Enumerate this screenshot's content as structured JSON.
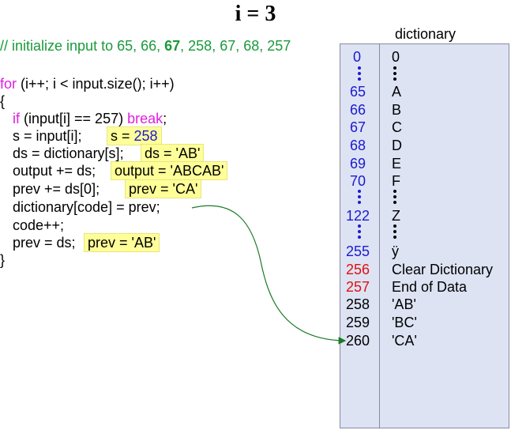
{
  "title": "i = 3",
  "code": {
    "comment_prefix": "// initialize input to 65, 66, ",
    "comment_bold": "67",
    "comment_suffix": ", 258, 67, 68, 257",
    "for_kw": "for",
    "for_rest": " (i++; i < input.size(); i++)",
    "open_brace": "{",
    "if_kw": "if",
    "if_mid": " (input[i] == 257) ",
    "break_kw": "break",
    "if_end": ";",
    "line_s": "s = input[i];",
    "hl_s_prefix": "s = ",
    "hl_s_value": "258",
    "line_ds": "ds = dictionary[s];",
    "hl_ds": "ds = 'AB'",
    "line_output": "output += ds;",
    "hl_output": "output = 'ABCAB'",
    "line_prev1": "prev += ds[0];",
    "hl_prev1": "prev = 'CA'",
    "line_dict": "dictionary[code] = prev;",
    "line_code": "code++;",
    "line_prev2": "prev = ds;",
    "hl_prev2": "prev = 'AB'",
    "close_brace": "}"
  },
  "dictionary": {
    "label": "dictionary",
    "rows": [
      {
        "code": "0",
        "entry": "0"
      },
      {
        "code": "65",
        "entry": "A"
      },
      {
        "code": "66",
        "entry": "B"
      },
      {
        "code": "67",
        "entry": "C"
      },
      {
        "code": "68",
        "entry": "D"
      },
      {
        "code": "69",
        "entry": "E"
      },
      {
        "code": "70",
        "entry": "F"
      },
      {
        "code": "122",
        "entry": "Z"
      },
      {
        "code": "255",
        "entry": "ÿ"
      },
      {
        "code": "256",
        "entry": "Clear Dictionary"
      },
      {
        "code": "257",
        "entry": "End of Data"
      },
      {
        "code": "258",
        "entry": "'AB'"
      },
      {
        "code": "259",
        "entry": "'BC'"
      },
      {
        "code": "260",
        "entry": "'CA'"
      }
    ]
  },
  "colors": {
    "comment": "#1a9a3a",
    "keyword": "#e020e0",
    "code_blue": "#1a1ad0",
    "code_red": "#e01010",
    "highlight": "#ffff99",
    "dictionary_bg": "#dde3f3",
    "arrow": "#1a7a2a"
  }
}
